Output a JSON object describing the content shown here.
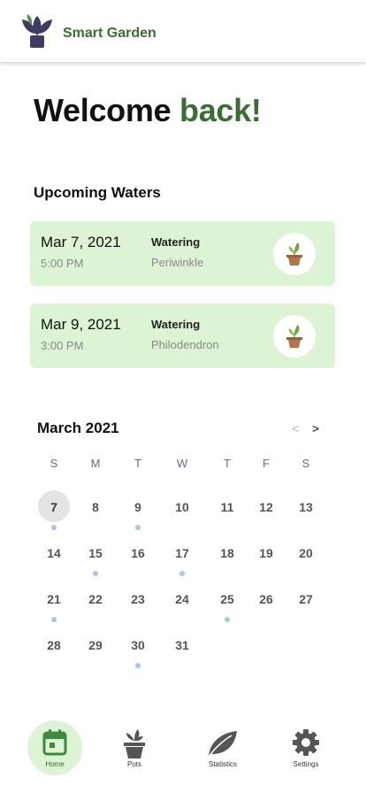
{
  "app": {
    "name": "Smart Garden"
  },
  "welcome": {
    "prefix": "Welcome",
    "accent": "back!"
  },
  "upcoming": {
    "title": "Upcoming Waters",
    "items": [
      {
        "date": "Mar 7, 2021",
        "time": "5:00 PM",
        "action": "Watering",
        "plant": "Periwinkle"
      },
      {
        "date": "Mar 9, 2021",
        "time": "3:00 PM",
        "action": "Watering",
        "plant": "Philodendron"
      }
    ]
  },
  "calendar": {
    "month": "March 2021",
    "prev": "<",
    "next": ">",
    "weekdays": [
      "S",
      "M",
      "T",
      "W",
      "T",
      "F",
      "S"
    ],
    "today": "7",
    "days": [
      {
        "label": "7",
        "dot": true
      },
      {
        "label": "8",
        "dot": false
      },
      {
        "label": "9",
        "dot": true
      },
      {
        "label": "10",
        "dot": false
      },
      {
        "label": "11",
        "dot": false
      },
      {
        "label": "12",
        "dot": false
      },
      {
        "label": "13",
        "dot": false
      },
      {
        "label": "14",
        "dot": false
      },
      {
        "label": "15",
        "dot": true
      },
      {
        "label": "16",
        "dot": false
      },
      {
        "label": "17",
        "dot": true
      },
      {
        "label": "18",
        "dot": false
      },
      {
        "label": "19",
        "dot": false
      },
      {
        "label": "20",
        "dot": false
      },
      {
        "label": "21",
        "dot": true
      },
      {
        "label": "22",
        "dot": false
      },
      {
        "label": "23",
        "dot": false
      },
      {
        "label": "24",
        "dot": false
      },
      {
        "label": "25",
        "dot": true
      },
      {
        "label": "26",
        "dot": false
      },
      {
        "label": "27",
        "dot": false
      },
      {
        "label": "28",
        "dot": false
      },
      {
        "label": "29",
        "dot": false
      },
      {
        "label": "30",
        "dot": true
      },
      {
        "label": "31",
        "dot": false
      }
    ]
  },
  "nav": {
    "items": [
      {
        "label": "Home",
        "icon": "calendar-icon",
        "active": true
      },
      {
        "label": "Pots",
        "icon": "pot-icon",
        "active": false
      },
      {
        "label": "Statistics",
        "icon": "leaf-icon",
        "active": false
      },
      {
        "label": "Settings",
        "icon": "gear-icon",
        "active": false
      }
    ]
  },
  "colors": {
    "accent": "#3b6d35",
    "card_bg": "#dcf3d4",
    "event_dot": "#a7c8ea",
    "weekday": "#5a6aa6"
  }
}
